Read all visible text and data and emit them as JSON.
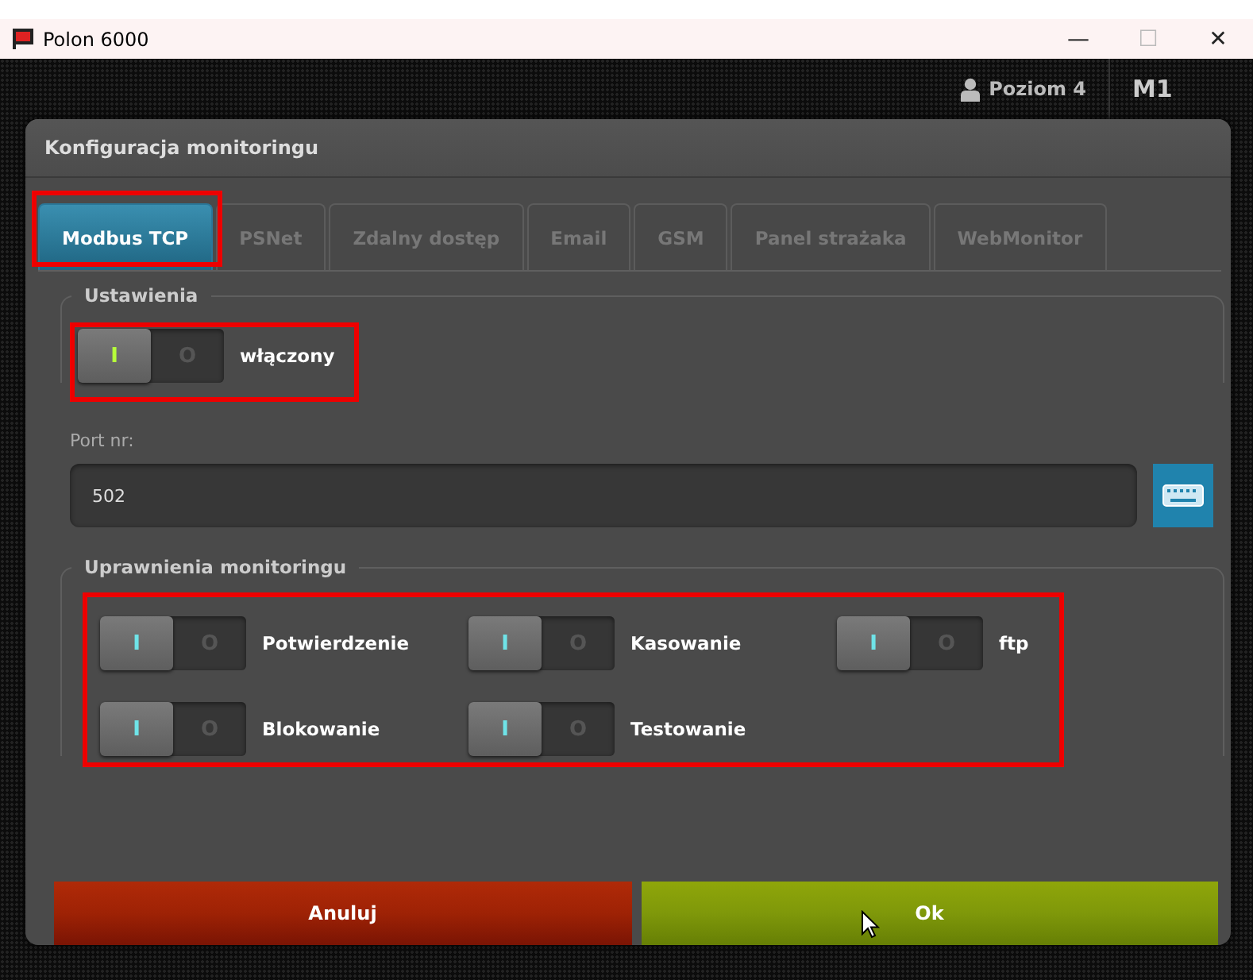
{
  "window": {
    "title": "Polon 6000",
    "controls": [
      "—",
      "☐",
      "✕"
    ]
  },
  "top_bar": {
    "level": "Poziom 4",
    "panel": "M1"
  },
  "dialog": {
    "title": "Konfiguracja monitoringu",
    "tabs": [
      {
        "label": "Modbus TCP",
        "selected": true
      },
      {
        "label": "PSNet",
        "selected": false
      },
      {
        "label": "Zdalny dostęp",
        "selected": false
      },
      {
        "label": "Email",
        "selected": false
      },
      {
        "label": "GSM",
        "selected": false
      },
      {
        "label": "Panel strażaka",
        "selected": false
      },
      {
        "label": "WebMonitor",
        "selected": false
      }
    ],
    "settings": {
      "legend": "Ustawienia",
      "toggle": {
        "label": "włączony",
        "on": true,
        "on_text": "I",
        "off_text": "O"
      }
    },
    "port": {
      "label": "Port nr:",
      "value": "502"
    },
    "permissions": {
      "legend": "Uprawnienia monitoringu",
      "toggles": [
        {
          "label": "Potwierdzenie",
          "on": true,
          "on_text": "I",
          "off_text": "O"
        },
        {
          "label": "Kasowanie",
          "on": true,
          "on_text": "I",
          "off_text": "O"
        },
        {
          "label": "ftp",
          "on": true,
          "on_text": "I",
          "off_text": "O"
        },
        {
          "label": "Blokowanie",
          "on": true,
          "on_text": "I",
          "off_text": "O"
        },
        {
          "label": "Testowanie",
          "on": true,
          "on_text": "I",
          "off_text": "O"
        }
      ]
    },
    "buttons": [
      {
        "label": "Anuluj",
        "kind": "cancel"
      },
      {
        "label": "Ok",
        "kind": "ok"
      }
    ]
  }
}
